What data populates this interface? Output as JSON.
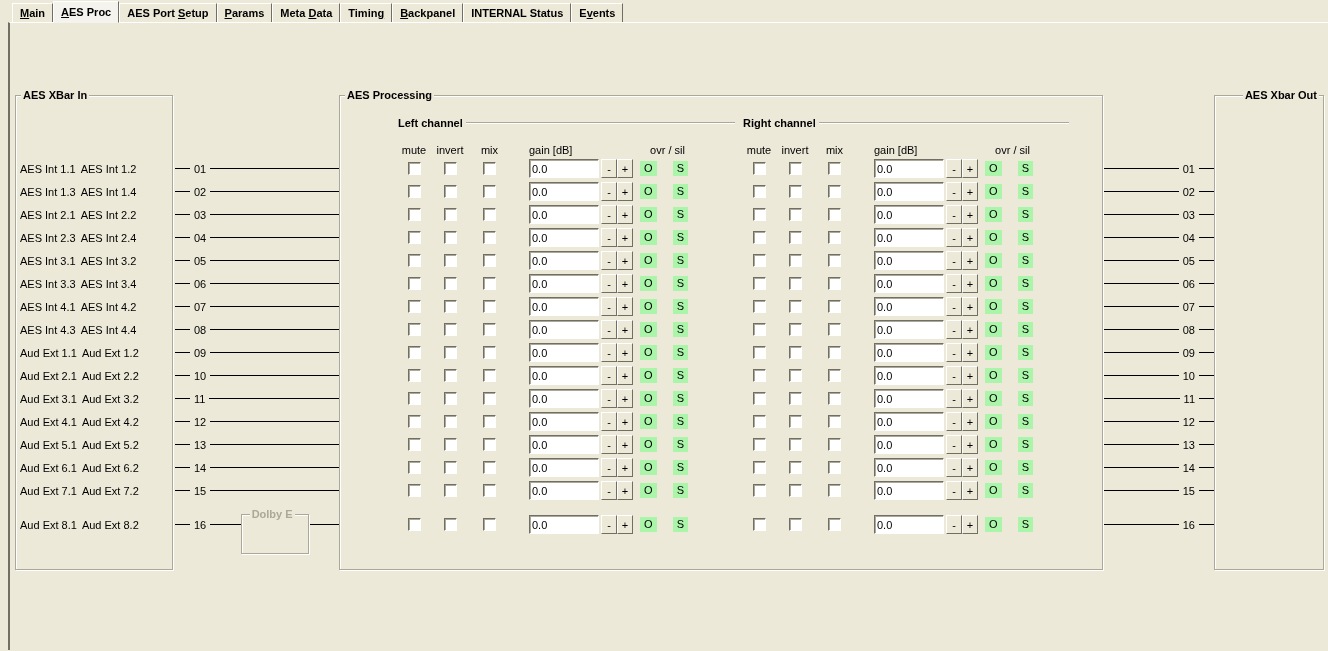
{
  "tabs": [
    {
      "access_key": "M",
      "label_rest": "ain",
      "selected": false
    },
    {
      "access_key": "A",
      "label_rest": "ES Proc",
      "selected": true
    },
    {
      "label_start": "AES Port ",
      "access_key": "S",
      "label_rest": "etup",
      "selected": false
    },
    {
      "access_key": "P",
      "label_rest": "arams",
      "selected": false
    },
    {
      "label_start": "Meta ",
      "access_key": "D",
      "label_rest": "ata",
      "selected": false
    },
    {
      "label_start": "Timin",
      "access_key": "g",
      "selected": false
    },
    {
      "access_key": "B",
      "label_rest": "ackpanel",
      "selected": false
    },
    {
      "label_start": "INTERNAL Status",
      "selected": false
    },
    {
      "label_start": "E",
      "access_key": "v",
      "label_rest": "ents",
      "selected": false
    }
  ],
  "xbar_in": {
    "title": "AES XBar In"
  },
  "processing": {
    "title": "AES Processing",
    "channels": [
      {
        "title": "Left channel",
        "column_labels": {
          "mute": "mute",
          "invert": "invert",
          "mix": "mix",
          "gain": "gain [dB]",
          "ovr_sil": "ovr / sil"
        }
      },
      {
        "title": "Right channel",
        "column_labels": {
          "mute": "mute",
          "invert": "invert",
          "mix": "mix",
          "gain": "gain [dB]",
          "ovr_sil": "ovr / sil"
        }
      }
    ]
  },
  "xbar_out": {
    "title": "AES Xbar Out"
  },
  "rows": [
    {
      "inputs": [
        "AES Int 1.1",
        "AES Int 1.2"
      ],
      "number": "01",
      "out_number": "01",
      "channels": [
        {
          "mute": false,
          "invert": false,
          "mix": false,
          "gain": "0.0",
          "minus": "-",
          "plus": "+",
          "ovr": "O",
          "ovr_on": true,
          "sil": "S",
          "sil_on": true
        },
        {
          "mute": false,
          "invert": false,
          "mix": false,
          "gain": "0.0",
          "minus": "-",
          "plus": "+",
          "ovr": "O",
          "ovr_on": true,
          "sil": "S",
          "sil_on": true
        }
      ]
    },
    {
      "inputs": [
        "AES Int 1.3",
        "AES Int 1.4"
      ],
      "number": "02",
      "out_number": "02",
      "channels": [
        {
          "mute": false,
          "invert": false,
          "mix": false,
          "gain": "0.0",
          "minus": "-",
          "plus": "+",
          "ovr": "O",
          "ovr_on": true,
          "sil": "S",
          "sil_on": true
        },
        {
          "mute": false,
          "invert": false,
          "mix": false,
          "gain": "0.0",
          "minus": "-",
          "plus": "+",
          "ovr": "O",
          "ovr_on": true,
          "sil": "S",
          "sil_on": true
        }
      ]
    },
    {
      "inputs": [
        "AES Int 2.1",
        "AES Int 2.2"
      ],
      "number": "03",
      "out_number": "03",
      "channels": [
        {
          "mute": false,
          "invert": false,
          "mix": false,
          "gain": "0.0",
          "minus": "-",
          "plus": "+",
          "ovr": "O",
          "ovr_on": true,
          "sil": "S",
          "sil_on": true
        },
        {
          "mute": false,
          "invert": false,
          "mix": false,
          "gain": "0.0",
          "minus": "-",
          "plus": "+",
          "ovr": "O",
          "ovr_on": true,
          "sil": "S",
          "sil_on": true
        }
      ]
    },
    {
      "inputs": [
        "AES Int 2.3",
        "AES Int 2.4"
      ],
      "number": "04",
      "out_number": "04",
      "channels": [
        {
          "mute": false,
          "invert": false,
          "mix": false,
          "gain": "0.0",
          "minus": "-",
          "plus": "+",
          "ovr": "O",
          "ovr_on": true,
          "sil": "S",
          "sil_on": true
        },
        {
          "mute": false,
          "invert": false,
          "mix": false,
          "gain": "0.0",
          "minus": "-",
          "plus": "+",
          "ovr": "O",
          "ovr_on": true,
          "sil": "S",
          "sil_on": true
        }
      ]
    },
    {
      "inputs": [
        "AES Int 3.1",
        "AES Int 3.2"
      ],
      "number": "05",
      "out_number": "05",
      "channels": [
        {
          "mute": false,
          "invert": false,
          "mix": false,
          "gain": "0.0",
          "minus": "-",
          "plus": "+",
          "ovr": "O",
          "ovr_on": true,
          "sil": "S",
          "sil_on": true
        },
        {
          "mute": false,
          "invert": false,
          "mix": false,
          "gain": "0.0",
          "minus": "-",
          "plus": "+",
          "ovr": "O",
          "ovr_on": true,
          "sil": "S",
          "sil_on": true
        }
      ]
    },
    {
      "inputs": [
        "AES Int 3.3",
        "AES Int 3.4"
      ],
      "number": "06",
      "out_number": "06",
      "channels": [
        {
          "mute": false,
          "invert": false,
          "mix": false,
          "gain": "0.0",
          "minus": "-",
          "plus": "+",
          "ovr": "O",
          "ovr_on": true,
          "sil": "S",
          "sil_on": true
        },
        {
          "mute": false,
          "invert": false,
          "mix": false,
          "gain": "0.0",
          "minus": "-",
          "plus": "+",
          "ovr": "O",
          "ovr_on": true,
          "sil": "S",
          "sil_on": true
        }
      ]
    },
    {
      "inputs": [
        "AES Int 4.1",
        "AES Int 4.2"
      ],
      "number": "07",
      "out_number": "07",
      "channels": [
        {
          "mute": false,
          "invert": false,
          "mix": false,
          "gain": "0.0",
          "minus": "-",
          "plus": "+",
          "ovr": "O",
          "ovr_on": true,
          "sil": "S",
          "sil_on": true
        },
        {
          "mute": false,
          "invert": false,
          "mix": false,
          "gain": "0.0",
          "minus": "-",
          "plus": "+",
          "ovr": "O",
          "ovr_on": true,
          "sil": "S",
          "sil_on": true
        }
      ]
    },
    {
      "inputs": [
        "AES Int 4.3",
        "AES Int 4.4"
      ],
      "number": "08",
      "out_number": "08",
      "channels": [
        {
          "mute": false,
          "invert": false,
          "mix": false,
          "gain": "0.0",
          "minus": "-",
          "plus": "+",
          "ovr": "O",
          "ovr_on": true,
          "sil": "S",
          "sil_on": true
        },
        {
          "mute": false,
          "invert": false,
          "mix": false,
          "gain": "0.0",
          "minus": "-",
          "plus": "+",
          "ovr": "O",
          "ovr_on": true,
          "sil": "S",
          "sil_on": true
        }
      ]
    },
    {
      "inputs": [
        "Aud Ext 1.1",
        "Aud Ext 1.2"
      ],
      "number": "09",
      "out_number": "09",
      "channels": [
        {
          "mute": false,
          "invert": false,
          "mix": false,
          "gain": "0.0",
          "minus": "-",
          "plus": "+",
          "ovr": "O",
          "ovr_on": true,
          "sil": "S",
          "sil_on": true
        },
        {
          "mute": false,
          "invert": false,
          "mix": false,
          "gain": "0.0",
          "minus": "-",
          "plus": "+",
          "ovr": "O",
          "ovr_on": true,
          "sil": "S",
          "sil_on": true
        }
      ]
    },
    {
      "inputs": [
        "Aud Ext 2.1",
        "Aud Ext 2.2"
      ],
      "number": "10",
      "out_number": "10",
      "channels": [
        {
          "mute": false,
          "invert": false,
          "mix": false,
          "gain": "0.0",
          "minus": "-",
          "plus": "+",
          "ovr": "O",
          "ovr_on": true,
          "sil": "S",
          "sil_on": true
        },
        {
          "mute": false,
          "invert": false,
          "mix": false,
          "gain": "0.0",
          "minus": "-",
          "plus": "+",
          "ovr": "O",
          "ovr_on": true,
          "sil": "S",
          "sil_on": true
        }
      ]
    },
    {
      "inputs": [
        "Aud Ext 3.1",
        "Aud Ext 3.2"
      ],
      "number": "11",
      "out_number": "11",
      "channels": [
        {
          "mute": false,
          "invert": false,
          "mix": false,
          "gain": "0.0",
          "minus": "-",
          "plus": "+",
          "ovr": "O",
          "ovr_on": true,
          "sil": "S",
          "sil_on": true
        },
        {
          "mute": false,
          "invert": false,
          "mix": false,
          "gain": "0.0",
          "minus": "-",
          "plus": "+",
          "ovr": "O",
          "ovr_on": true,
          "sil": "S",
          "sil_on": true
        }
      ]
    },
    {
      "inputs": [
        "Aud Ext 4.1",
        "Aud Ext 4.2"
      ],
      "number": "12",
      "out_number": "12",
      "channels": [
        {
          "mute": false,
          "invert": false,
          "mix": false,
          "gain": "0.0",
          "minus": "-",
          "plus": "+",
          "ovr": "O",
          "ovr_on": true,
          "sil": "S",
          "sil_on": true
        },
        {
          "mute": false,
          "invert": false,
          "mix": false,
          "gain": "0.0",
          "minus": "-",
          "plus": "+",
          "ovr": "O",
          "ovr_on": true,
          "sil": "S",
          "sil_on": true
        }
      ]
    },
    {
      "inputs": [
        "Aud Ext 5.1",
        "Aud Ext 5.2"
      ],
      "number": "13",
      "out_number": "13",
      "channels": [
        {
          "mute": false,
          "invert": false,
          "mix": false,
          "gain": "0.0",
          "minus": "-",
          "plus": "+",
          "ovr": "O",
          "ovr_on": true,
          "sil": "S",
          "sil_on": true
        },
        {
          "mute": false,
          "invert": false,
          "mix": false,
          "gain": "0.0",
          "minus": "-",
          "plus": "+",
          "ovr": "O",
          "ovr_on": true,
          "sil": "S",
          "sil_on": true
        }
      ]
    },
    {
      "inputs": [
        "Aud Ext 6.1",
        "Aud Ext 6.2"
      ],
      "number": "14",
      "out_number": "14",
      "channels": [
        {
          "mute": false,
          "invert": false,
          "mix": false,
          "gain": "0.0",
          "minus": "-",
          "plus": "+",
          "ovr": "O",
          "ovr_on": true,
          "sil": "S",
          "sil_on": true
        },
        {
          "mute": false,
          "invert": false,
          "mix": false,
          "gain": "0.0",
          "minus": "-",
          "plus": "+",
          "ovr": "O",
          "ovr_on": true,
          "sil": "S",
          "sil_on": true
        }
      ]
    },
    {
      "inputs": [
        "Aud Ext 7.1",
        "Aud Ext 7.2"
      ],
      "number": "15",
      "out_number": "15",
      "channels": [
        {
          "mute": false,
          "invert": false,
          "mix": false,
          "gain": "0.0",
          "minus": "-",
          "plus": "+",
          "ovr": "O",
          "ovr_on": true,
          "sil": "S",
          "sil_on": true
        },
        {
          "mute": false,
          "invert": false,
          "mix": false,
          "gain": "0.0",
          "minus": "-",
          "plus": "+",
          "ovr": "O",
          "ovr_on": true,
          "sil": "S",
          "sil_on": true
        }
      ]
    },
    {
      "inputs": [
        "Aud Ext 8.1",
        "Aud Ext 8.2"
      ],
      "number": "16",
      "out_number": "16",
      "decoder": {
        "label": "Dolby E",
        "disabled": true
      },
      "channels": [
        {
          "mute": false,
          "invert": false,
          "mix": false,
          "gain": "0.0",
          "minus": "-",
          "plus": "+",
          "ovr": "O",
          "ovr_on": true,
          "sil": "S",
          "sil_on": true
        },
        {
          "mute": false,
          "invert": false,
          "mix": false,
          "gain": "0.0",
          "minus": "-",
          "plus": "+",
          "ovr": "O",
          "ovr_on": true,
          "sil": "S",
          "sil_on": true
        }
      ]
    }
  ]
}
